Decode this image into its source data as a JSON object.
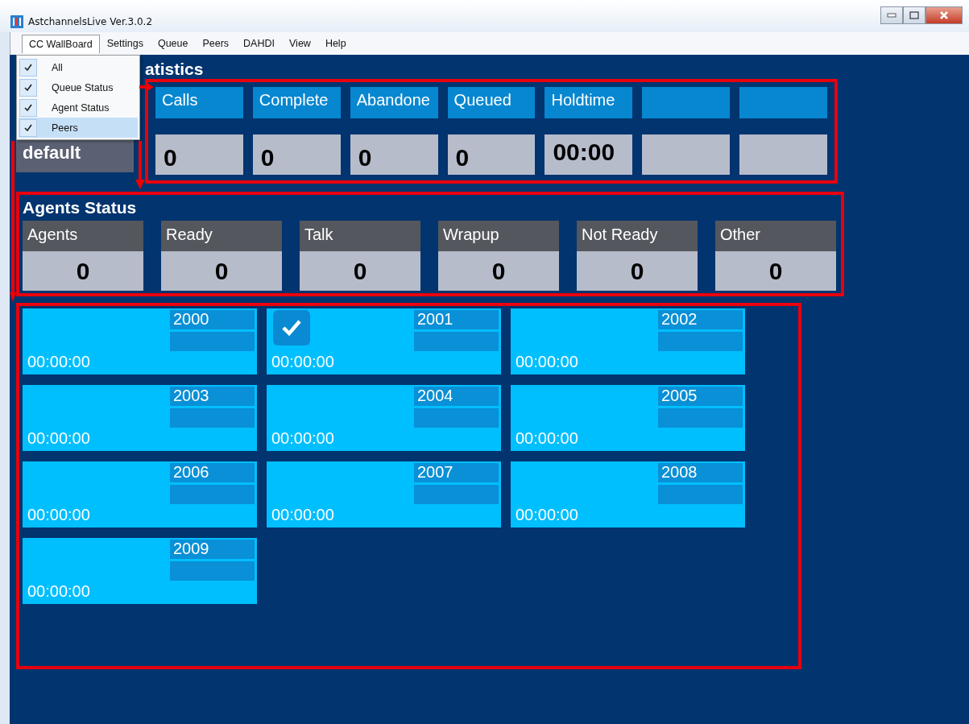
{
  "window": {
    "title": "AstchannelsLive Ver.3.0.2"
  },
  "menu_bar": [
    {
      "label": "CC WallBoard",
      "selected": true
    },
    {
      "label": "Settings",
      "selected": false
    },
    {
      "label": "Queue",
      "selected": false
    },
    {
      "label": "Peers",
      "selected": false
    },
    {
      "label": "DAHDI",
      "selected": false
    },
    {
      "label": "View",
      "selected": false
    },
    {
      "label": "Help",
      "selected": false
    }
  ],
  "dropdown": [
    {
      "label": "All",
      "checked": true,
      "selected": false
    },
    {
      "label": "Queue Status",
      "checked": true,
      "selected": false
    },
    {
      "label": "Agent Status",
      "checked": true,
      "selected": false
    },
    {
      "label": "Peers",
      "checked": true,
      "selected": true
    }
  ],
  "queue_statistics": {
    "title": "atistics",
    "queue": "default",
    "columns": [
      {
        "kind": "stat",
        "label": "Calls",
        "value": "0"
      },
      {
        "kind": "stat",
        "label": "Complete",
        "value": "0"
      },
      {
        "kind": "stat",
        "label": "Abandone",
        "value": "0"
      },
      {
        "kind": "stat",
        "label": "Queued",
        "value": "0"
      },
      {
        "kind": "stat",
        "label": "Holdtime",
        "value": "00:00"
      },
      {
        "kind": "empty"
      },
      {
        "kind": "empty"
      }
    ]
  },
  "agents_status": {
    "title": "Agents Status",
    "columns": [
      {
        "label": "Agents",
        "value": "0"
      },
      {
        "label": "Ready",
        "value": "0"
      },
      {
        "label": "Talk",
        "value": "0"
      },
      {
        "label": "Wrapup",
        "value": "0"
      },
      {
        "label": "Not Ready",
        "value": "0"
      },
      {
        "label": "Other",
        "value": "0"
      }
    ]
  },
  "peers": [
    {
      "number": "2000",
      "time": "00:00:00",
      "checked": false
    },
    {
      "number": "2001",
      "time": "00:00:00",
      "checked": true
    },
    {
      "number": "2002",
      "time": "00:00:00",
      "checked": false
    },
    {
      "number": "2003",
      "time": "00:00:00",
      "checked": false
    },
    {
      "number": "2004",
      "time": "00:00:00",
      "checked": false
    },
    {
      "number": "2005",
      "time": "00:00:00",
      "checked": false
    },
    {
      "number": "2006",
      "time": "00:00:00",
      "checked": false
    },
    {
      "number": "2007",
      "time": "00:00:00",
      "checked": false
    },
    {
      "number": "2008",
      "time": "00:00:00",
      "checked": false
    },
    {
      "number": "2009",
      "time": "00:00:00",
      "checked": false
    }
  ]
}
